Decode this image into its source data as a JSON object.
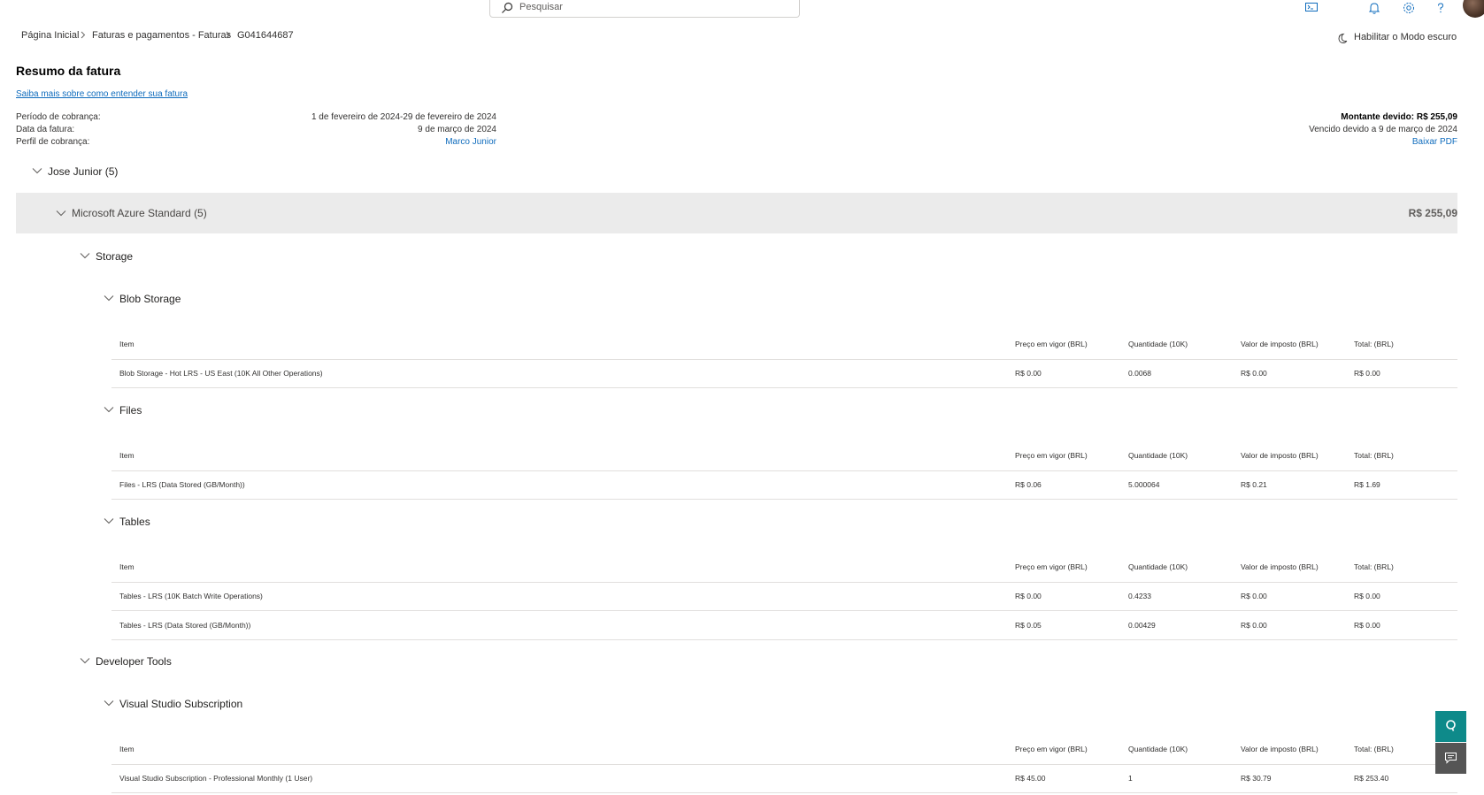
{
  "topbar": {
    "search_placeholder": "Pesquisar"
  },
  "breadcrumb": {
    "home": "Página Inicial",
    "billing": "Faturas e pagamentos - Faturas",
    "invoice_id": "G041644687"
  },
  "dark_mode_label": "Habilitar o Modo escuro",
  "summary": {
    "title": "Resumo da fatura",
    "learn_link": "Saiba mais sobre como entender sua fatura",
    "period_label": "Período de cobrança:",
    "period_value": "1 de fevereiro de 2024-29 de fevereiro de 2024",
    "date_label": "Data da fatura:",
    "date_value": "9 de março de 2024",
    "profile_label": "Perfil de cobrança:",
    "profile_value": "Marco Junior",
    "amount_due": "Montante devido: R$ 255,09",
    "due_text": "Vencido devido a 9 de março de 2024",
    "download_pdf": "Baixar PDF"
  },
  "groups": {
    "owner": "Jose Junior (5)",
    "subscription": "Microsoft Azure Standard (5)",
    "subscription_amount": "R$ 255,09",
    "storage": "Storage",
    "blob": "Blob Storage",
    "files": "Files",
    "tables": "Tables",
    "devtools": "Developer Tools",
    "vss": "Visual Studio Subscription"
  },
  "columns": {
    "item": "Item",
    "price": "Preço em vigor (BRL)",
    "qty": "Quantidade (10K)",
    "tax": "Valor de imposto (BRL)",
    "total": "Total: (BRL)"
  },
  "rows": {
    "blob": [
      {
        "item": "Blob Storage - Hot LRS - US East (10K All Other Operations)",
        "price": "R$ 0.00",
        "qty": "0.0068",
        "tax": "R$ 0.00",
        "total": "R$ 0.00"
      }
    ],
    "files": [
      {
        "item": "Files - LRS (Data Stored (GB/Month))",
        "price": "R$ 0.06",
        "qty": "5.000064",
        "tax": "R$ 0.21",
        "total": "R$ 1.69"
      }
    ],
    "tables": [
      {
        "item": "Tables - LRS (10K Batch Write Operations)",
        "price": "R$ 0.00",
        "qty": "0.4233",
        "tax": "R$ 0.00",
        "total": "R$ 0.00"
      },
      {
        "item": "Tables - LRS (Data Stored (GB/Month))",
        "price": "R$ 0.05",
        "qty": "0.00429",
        "tax": "R$ 0.00",
        "total": "R$ 0.00"
      }
    ],
    "vss": [
      {
        "item": "Visual Studio Subscription - Professional Monthly (1 User)",
        "price": "R$ 45.00",
        "qty": "1",
        "tax": "R$ 30.79",
        "total": "R$ 253.40"
      }
    ]
  },
  "colors": {
    "accent": "#0f6cbd",
    "band": "#ebebeb",
    "side_button_primary": "#0e8a8a",
    "side_button_secondary": "#555555"
  }
}
